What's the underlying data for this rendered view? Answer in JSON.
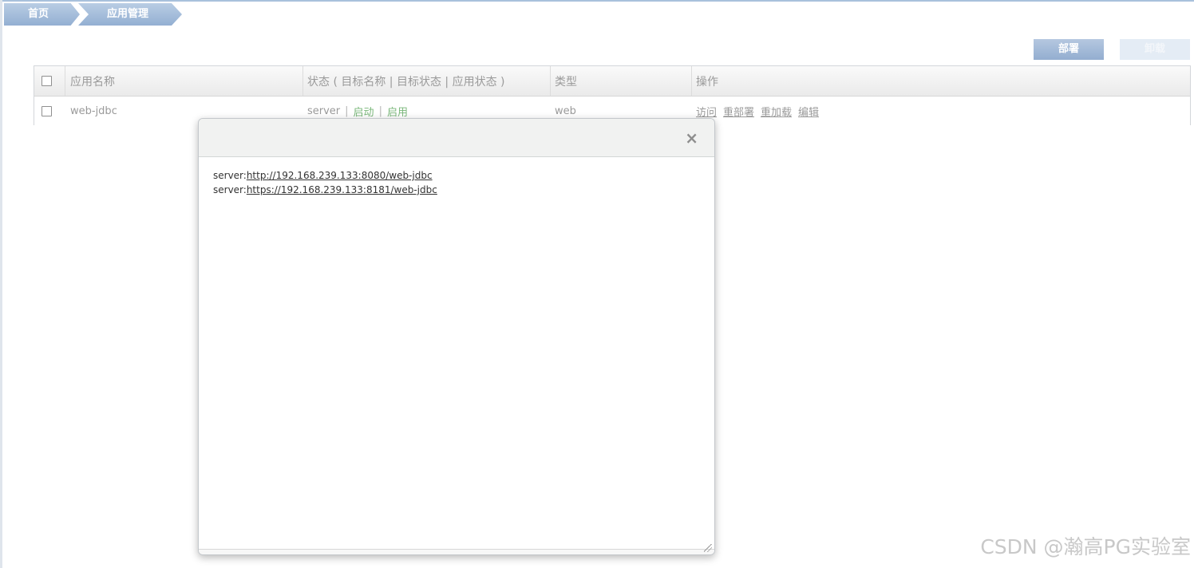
{
  "breadcrumb": {
    "home": "首页",
    "current": "应用管理"
  },
  "toolbar": {
    "deploy_label": "部署",
    "undeploy_label": "卸载"
  },
  "table": {
    "headers": {
      "name": "应用名称",
      "status": "状态 ( 目标名称 | 目标状态 | 应用状态 )",
      "type": "类型",
      "ops": "操作"
    },
    "rows": [
      {
        "name": "web-jdbc",
        "target": "server",
        "target_status": "启动",
        "app_status": "启用",
        "type": "web",
        "ops": [
          "访问",
          "重部署",
          "重加载",
          "编辑"
        ]
      }
    ]
  },
  "modal": {
    "close_glyph": "×",
    "links": [
      {
        "prefix": "server:",
        "url": "http://192.168.239.133:8080/web-jdbc"
      },
      {
        "prefix": "server:",
        "url": "https://192.168.239.133:8181/web-jdbc"
      }
    ]
  },
  "watermark": "CSDN @瀚高PG实验室",
  "colors": {
    "accent": "#93afd2",
    "status_green": "#7ab77a"
  }
}
